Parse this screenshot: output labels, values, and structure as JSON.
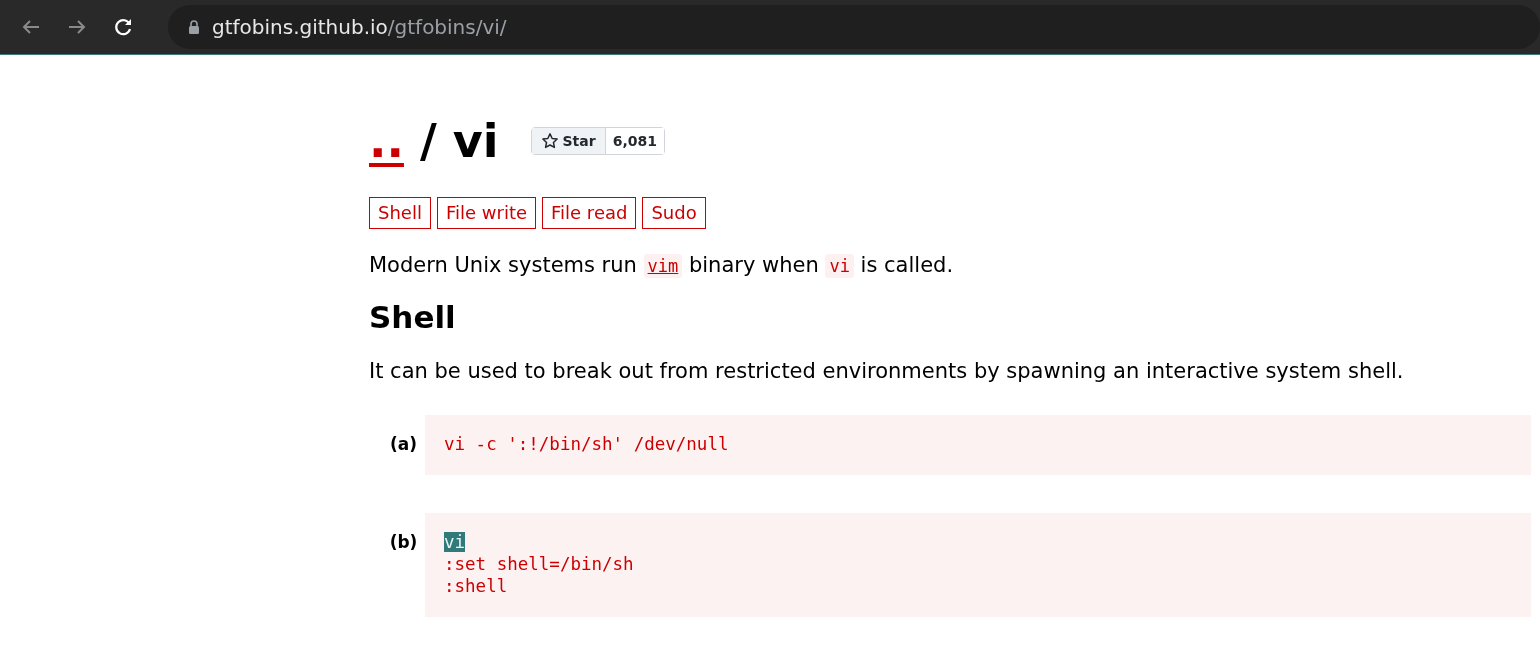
{
  "browser": {
    "url_host": "gtfobins.github.io",
    "url_path": "/gtfobins/vi/"
  },
  "title": {
    "parent_link": "..",
    "separator": "/",
    "name": "vi"
  },
  "star_button": {
    "label": "Star",
    "count": "6,081"
  },
  "tags": [
    "Shell",
    "File write",
    "File read",
    "Sudo"
  ],
  "intro": [
    {
      "kind": "text",
      "text": "Modern Unix systems run "
    },
    {
      "kind": "code_link",
      "text": "vim"
    },
    {
      "kind": "text",
      "text": " binary when "
    },
    {
      "kind": "code",
      "text": "vi"
    },
    {
      "kind": "text",
      "text": " is called."
    }
  ],
  "section": {
    "heading": "Shell",
    "description": "It can be used to break out from restricted environments by spawning an interactive system shell."
  },
  "examples": [
    {
      "label": "(a)",
      "lines": [
        {
          "text": "vi -c ':!/bin/sh' /dev/null",
          "selected": false
        }
      ]
    },
    {
      "label": "(b)",
      "lines": [
        {
          "text": "vi",
          "selected": true
        },
        {
          "text": ":set shell=/bin/sh",
          "selected": false
        },
        {
          "text": ":shell",
          "selected": false
        }
      ]
    }
  ]
}
